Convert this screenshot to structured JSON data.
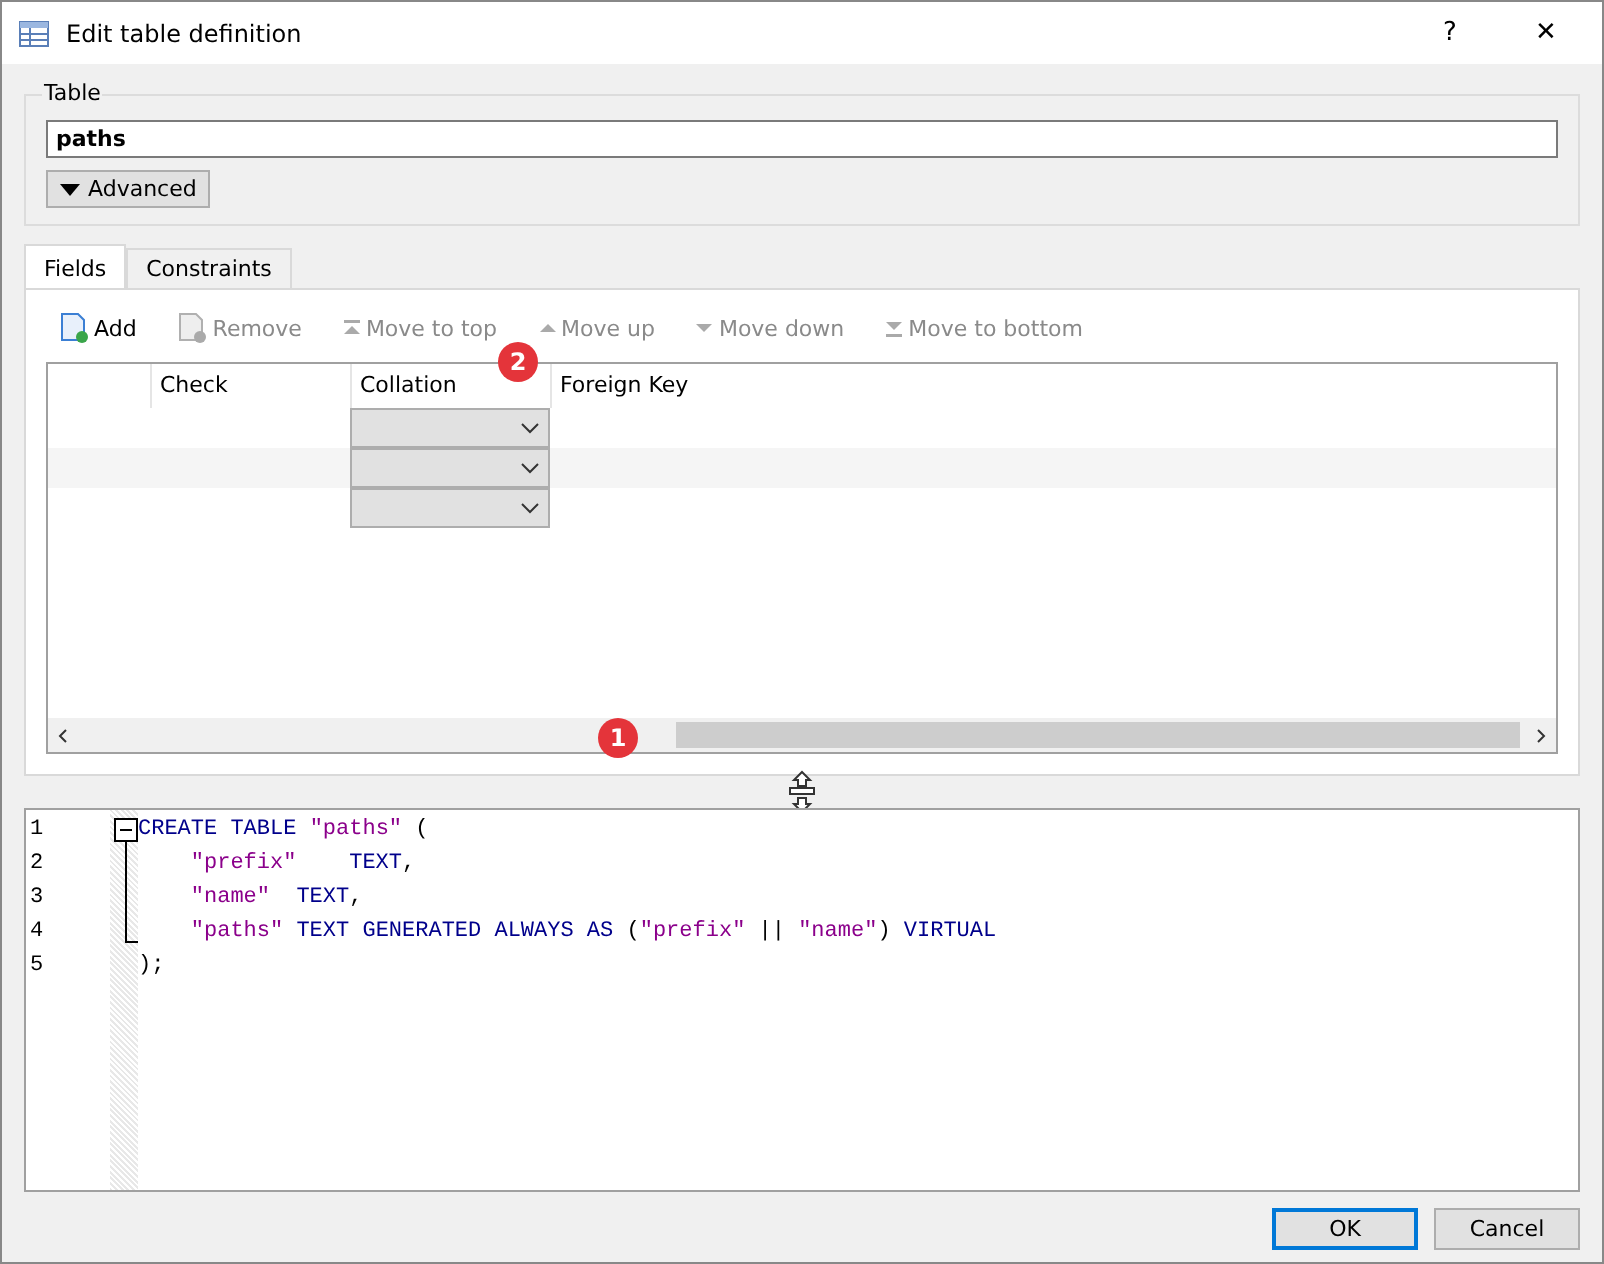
{
  "window": {
    "title": "Edit table definition",
    "help": "?",
    "close": "✕"
  },
  "table_group": {
    "label": "Table",
    "name": "paths",
    "advanced_button": "Advanced"
  },
  "tabs": [
    {
      "label": "Fields",
      "selected": true
    },
    {
      "label": "Constraints",
      "selected": false
    }
  ],
  "toolbar": [
    {
      "label": "Add",
      "kind": "add",
      "disabled": false
    },
    {
      "label": "Remove",
      "kind": "remove",
      "disabled": true
    },
    {
      "label": "Move to top",
      "kind": "top",
      "disabled": true
    },
    {
      "label": "Move up",
      "kind": "up",
      "disabled": true
    },
    {
      "label": "Move down",
      "kind": "down",
      "disabled": true
    },
    {
      "label": "Move to bottom",
      "kind": "bottom",
      "disabled": true
    }
  ],
  "grid": {
    "columns": [
      "Check",
      "Collation",
      "Foreign Key"
    ],
    "rows": [
      {
        "kind": "combo"
      },
      {
        "kind": "combo"
      },
      {
        "kind": "combo"
      }
    ]
  },
  "badges": [
    {
      "text": "2"
    },
    {
      "text": "1"
    }
  ],
  "sql": [
    [
      {
        "kind": "kw",
        "text": "CREATE TABLE "
      },
      {
        "kind": "str",
        "text": "\"paths\""
      },
      {
        "kind": "p",
        "text": " ("
      }
    ],
    [
      {
        "kind": "str",
        "text": "\"prefix\"    "
      },
      {
        "kind": "kw",
        "text": "TEXT"
      },
      {
        "kind": "p",
        "text": ","
      }
    ],
    [
      {
        "kind": "str",
        "text": "\"name\"  "
      },
      {
        "kind": "kw",
        "text": "TEXT"
      },
      {
        "kind": "p",
        "text": ","
      }
    ],
    [
      {
        "kind": "str",
        "text": "\"paths\""
      },
      {
        "kind": "kw",
        "text": " TEXT GENERATED ALWAYS AS "
      },
      {
        "kind": "p",
        "text": "("
      },
      {
        "kind": "str",
        "text": "\"prefix\""
      },
      {
        "kind": "p",
        "text": " || "
      },
      {
        "kind": "str",
        "text": "\"name\""
      },
      {
        "kind": "p",
        "text": ") "
      },
      {
        "kind": "kw",
        "text": "VIRTUAL"
      }
    ],
    [
      {
        "kind": "p",
        "text": ");"
      }
    ]
  ],
  "line_numbers": [
    "1",
    "2",
    "3",
    "4",
    "5"
  ],
  "buttons": [
    {
      "label": "OK",
      "default": true
    },
    {
      "label": "Cancel",
      "default": false
    }
  ]
}
